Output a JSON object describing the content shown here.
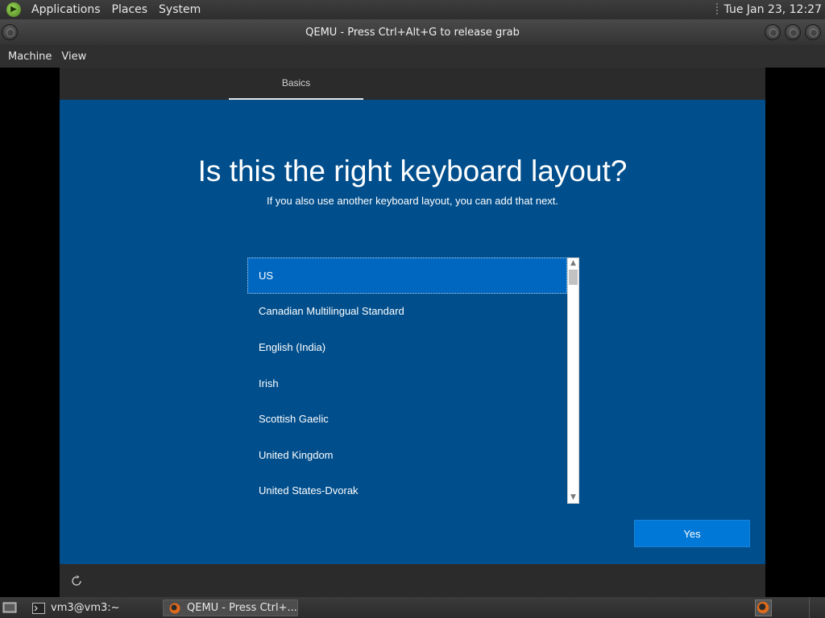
{
  "top_panel": {
    "menus": [
      "Applications",
      "Places",
      "System"
    ],
    "clock": "Tue Jan 23, 12:27"
  },
  "window": {
    "title": "QEMU - Press Ctrl+Alt+G to release grab",
    "menus": [
      "Machine",
      "View"
    ]
  },
  "oobe": {
    "tab": "Basics",
    "title": "Is this the right keyboard layout?",
    "subtitle": "If you also use another keyboard layout, you can add that next.",
    "layouts": [
      "US",
      "Canadian Multilingual Standard",
      "English (India)",
      "Irish",
      "Scottish Gaelic",
      "United Kingdom",
      "United States-Dvorak"
    ],
    "selected_layout": "US",
    "yes_label": "Yes",
    "colors": {
      "background": "#004e8c",
      "selected": "#0067c0",
      "button": "#0078d7"
    }
  },
  "taskbar": {
    "tasks": [
      "vm3@vm3:~",
      "QEMU - Press Ctrl+..."
    ],
    "active_task": "QEMU - Press Ctrl+..."
  }
}
